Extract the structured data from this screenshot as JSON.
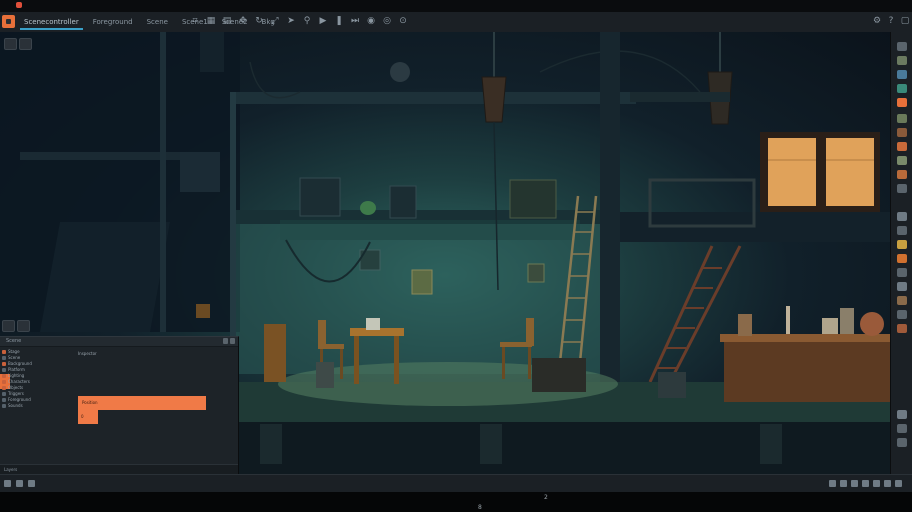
{
  "toolbar": {
    "tabs": [
      "Scenecontroller",
      "Foreground",
      "Scene",
      "Scene1",
      "Scene2",
      "Bkg"
    ],
    "icons": [
      "snap-icon",
      "grid-icon",
      "layer-icon",
      "move-icon",
      "rotate-icon",
      "scale-icon",
      "cursor-icon",
      "pin-icon",
      "play-icon",
      "pause-icon",
      "step-icon",
      "camera-icon",
      "eye-icon",
      "lock-icon"
    ],
    "right_icons": [
      "settings-icon",
      "help-icon",
      "window-icon"
    ]
  },
  "scene_panel": {
    "title": "Scene",
    "inspector_title": "Inspector",
    "tree": [
      "Stage",
      "Scene",
      "Background",
      "Platform",
      "Lighting",
      "Characters",
      "Objects",
      "Triggers",
      "Foreground",
      "Sounds"
    ],
    "selected_property": "Position",
    "selected_property_value": "0",
    "footer": "Layers"
  },
  "colors": {
    "accent": "#e8703a",
    "selection": "#f07a47",
    "tab_highlight": "#3aa0c8",
    "panel": "#1d2328",
    "chrome": "#1b2025"
  },
  "statusbar": {
    "left_icons": [
      "refresh-icon",
      "console-icon",
      "search-icon"
    ],
    "right_icons": [
      "play-icon",
      "record-icon",
      "camera-icon",
      "audio-icon",
      "export-icon",
      "share-icon",
      "fullscreen-icon"
    ]
  },
  "bottomstrip": {
    "glyph_a": "2",
    "glyph_b": "8"
  }
}
